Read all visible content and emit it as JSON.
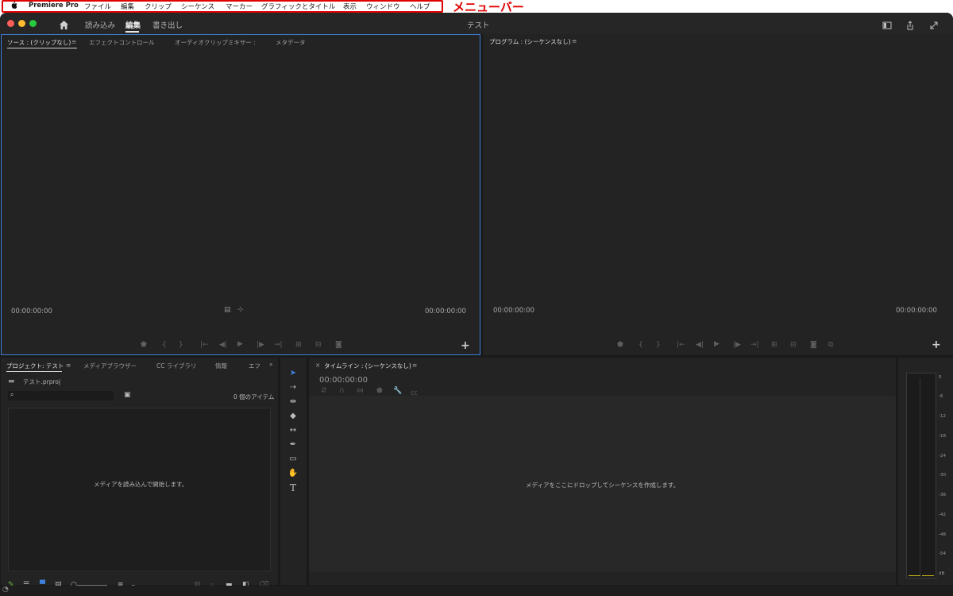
{
  "menubar": {
    "app_name": "Premiere Pro",
    "items": [
      "ファイル",
      "編集",
      "クリップ",
      "シーケンス",
      "マーカー",
      "グラフィックとタイトル",
      "表示",
      "ウィンドウ",
      "ヘルプ"
    ],
    "annotation": "メニューバー",
    "annotation_color": "#e00000"
  },
  "titlebar": {
    "workspaces": [
      "読み込み",
      "編集",
      "書き出し"
    ],
    "active_workspace": "編集",
    "document_title": "テスト"
  },
  "source_panel": {
    "tabs": [
      "ソース : (クリップなし)",
      "エフェクトコントロール",
      "オーディオクリップミキサー :",
      "メタデータ"
    ],
    "timecode_left": "00:00:00:00",
    "timecode_right": "00:00:00:00"
  },
  "program_panel": {
    "tab": "プログラム : (シーケンスなし)",
    "timecode_left": "00:00:00:00",
    "timecode_right": "00:00:00:00"
  },
  "project_panel": {
    "tabs": [
      "プロジェクト: テスト",
      "メディアブラウザー",
      "CC ライブラリ",
      "情報",
      "エフ"
    ],
    "project_file": "テスト.prproj",
    "item_count": "0 個のアイテム",
    "empty_hint": "メディアを読み込んで開始します。"
  },
  "timeline_panel": {
    "tab": "タイムライン : (シーケンスなし)",
    "timecode": "00:00:00:00",
    "empty_hint": "メディアをここにドロップしてシーケンスを作成します。"
  },
  "audio_meter": {
    "labels": [
      "0",
      "-6",
      "-12",
      "-18",
      "-24",
      "-30",
      "-36",
      "-42",
      "-48",
      "-54",
      "dB"
    ]
  },
  "colors": {
    "accent_blue": "#3f7fd9",
    "panel_bg": "#232323",
    "window_bg": "#1a1a1a"
  }
}
